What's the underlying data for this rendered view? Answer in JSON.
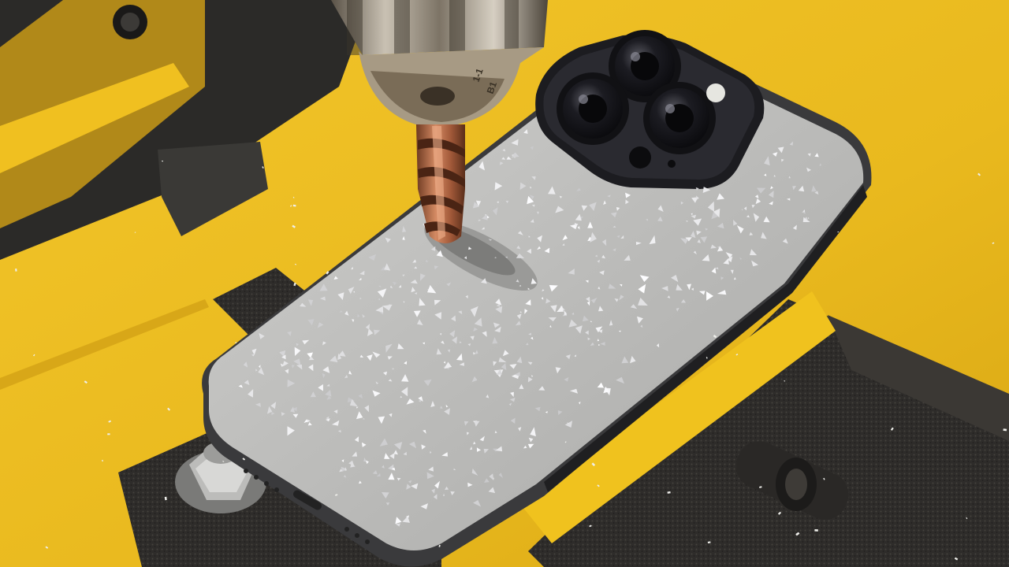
{
  "scene": {
    "chuck_marking_1": "1-1",
    "chuck_marking_2": "B1"
  },
  "colors": {
    "table_yellow": "#e8b81c",
    "phone_body": "#bdbdbb",
    "drill_bit": "#b86d4b",
    "vise_dark": "#2e2c2a"
  }
}
